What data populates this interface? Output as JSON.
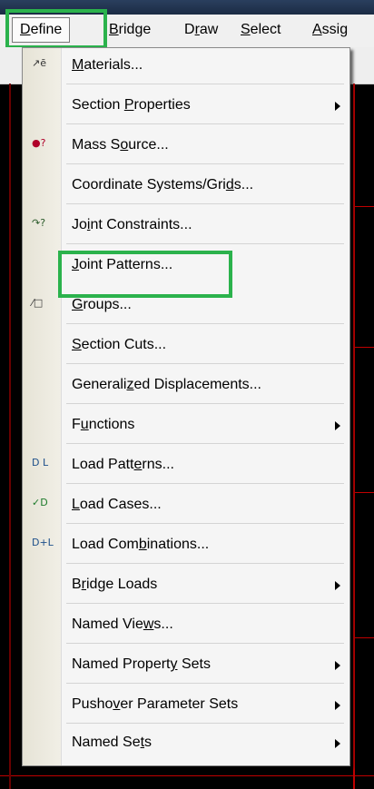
{
  "menubar": {
    "items": [
      {
        "pre": "",
        "u": "D",
        "post": "efine"
      },
      {
        "pre": "",
        "u": "B",
        "post": "ridge"
      },
      {
        "pre": "D",
        "u": "r",
        "post": "aw"
      },
      {
        "pre": "",
        "u": "S",
        "post": "elect"
      },
      {
        "pre": "",
        "u": "A",
        "post": "ssig"
      }
    ]
  },
  "menu": {
    "items": [
      {
        "pre": "",
        "u": "M",
        "post": "aterials...",
        "icon": "materials-icon",
        "submenu": false
      },
      {
        "pre": "Section ",
        "u": "P",
        "post": "roperties",
        "icon": "",
        "submenu": true
      },
      {
        "pre": "Mass S",
        "u": "o",
        "post": "urce...",
        "icon": "mass-source-icon",
        "submenu": false
      },
      {
        "pre": "Coordinate Systems/Gri",
        "u": "d",
        "post": "s...",
        "icon": "",
        "submenu": false
      },
      {
        "pre": "Jo",
        "u": "i",
        "post": "nt Constraints...",
        "icon": "joint-constraints-icon",
        "submenu": false
      },
      {
        "pre": "",
        "u": "J",
        "post": "oint Patterns...",
        "icon": "",
        "submenu": false
      },
      {
        "pre": "",
        "u": "G",
        "post": "roups...",
        "icon": "groups-icon",
        "submenu": false
      },
      {
        "pre": "",
        "u": "S",
        "post": "ection Cuts...",
        "icon": "",
        "submenu": false
      },
      {
        "pre": "Generali",
        "u": "z",
        "post": "ed Displacements...",
        "icon": "",
        "submenu": false
      },
      {
        "pre": "F",
        "u": "u",
        "post": "nctions",
        "icon": "",
        "submenu": true
      },
      {
        "pre": "Load Patt",
        "u": "e",
        "post": "rns...",
        "icon": "load-patterns-icon",
        "submenu": false
      },
      {
        "pre": "",
        "u": "L",
        "post": "oad Cases...",
        "icon": "load-cases-icon",
        "submenu": false
      },
      {
        "pre": "Load Com",
        "u": "b",
        "post": "inations...",
        "icon": "load-combinations-icon",
        "submenu": false
      },
      {
        "pre": "B",
        "u": "r",
        "post": "idge Loads",
        "icon": "",
        "submenu": true
      },
      {
        "pre": "Named Vie",
        "u": "w",
        "post": "s...",
        "icon": "",
        "submenu": false
      },
      {
        "pre": "Named Propert",
        "u": "y",
        "post": " Sets",
        "icon": "",
        "submenu": true
      },
      {
        "pre": "Pusho",
        "u": "v",
        "post": "er Parameter Sets",
        "icon": "",
        "submenu": true
      },
      {
        "pre": "Named Se",
        "u": "t",
        "post": "s",
        "icon": "",
        "submenu": true
      }
    ]
  },
  "icons": {
    "materials": "↗ē",
    "mass_source": "●?",
    "joint_constraints": "↷?",
    "groups": "⁄□",
    "load_patterns": "D L",
    "load_cases": "✓D",
    "load_combinations": "D+L"
  },
  "colors": {
    "highlight": "#2bb24c",
    "accent_red": "#c00000"
  }
}
